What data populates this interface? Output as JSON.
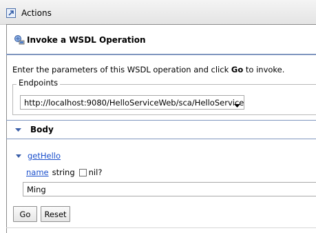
{
  "titlebar": {
    "title": "Actions",
    "icon": "actions-icon"
  },
  "panel": {
    "heading": "Invoke a WSDL Operation",
    "heading_icon": "wsdl-operation-icon",
    "description_before": "Enter the parameters of this WSDL operation and click ",
    "description_bold": "Go",
    "description_after": " to invoke."
  },
  "endpoints": {
    "legend": "Endpoints",
    "selected": "http://localhost:9080/HelloServiceWeb/sca/HelloService"
  },
  "body_section": {
    "label": "Body",
    "expanded": true
  },
  "operation": {
    "name": "getHello",
    "expanded": true,
    "param": {
      "name": "name",
      "type": "string",
      "nil_label": "nil?",
      "nil_checked": false,
      "value": "Ming"
    }
  },
  "buttons": {
    "go": "Go",
    "reset": "Reset"
  },
  "colors": {
    "link": "#1a4fcc",
    "separator": "#7f95bf",
    "twisty": "#3a5ea8"
  }
}
